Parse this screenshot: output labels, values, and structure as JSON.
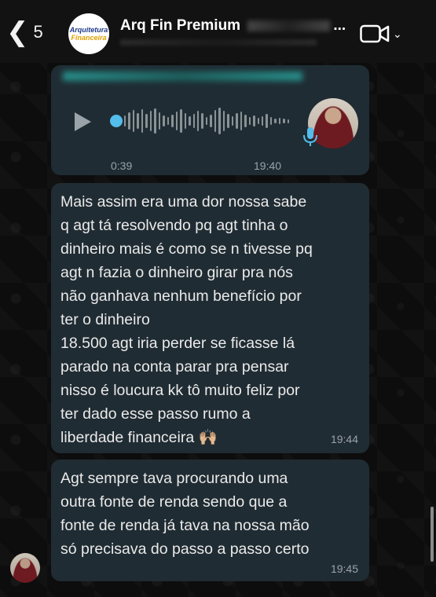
{
  "header": {
    "back_count": "5",
    "chat_title": "Arq Fin Premium",
    "title_suffix": "...",
    "logo_line1": "Arquitetura",
    "logo_line2": "Financeira"
  },
  "voice_message": {
    "duration": "0:39",
    "time": "19:40"
  },
  "messages": [
    {
      "text": "Mais assim era uma dor nossa sabe\nq agt tá resolvendo pq agt tinha o\ndinheiro mais é como se n tivesse pq\nagt n fazia o dinheiro girar pra nós\nnão ganhava nenhum benefício por\nter o dinheiro\n18.500 agt iria perder se ficasse lá\nparado na conta parar pra pensar\nnisso é loucura kk tô muito feliz por\nter dado esse passo rumo a\nliberdade financeira 🙌🏼",
      "time": "19:44"
    },
    {
      "text": "Agt sempre tava procurando uma\noutra fonte de renda sendo que a\nfonte de renda já tava na nossa mão\nsó precisava do passo a passo certo",
      "time": "19:45"
    }
  ]
}
